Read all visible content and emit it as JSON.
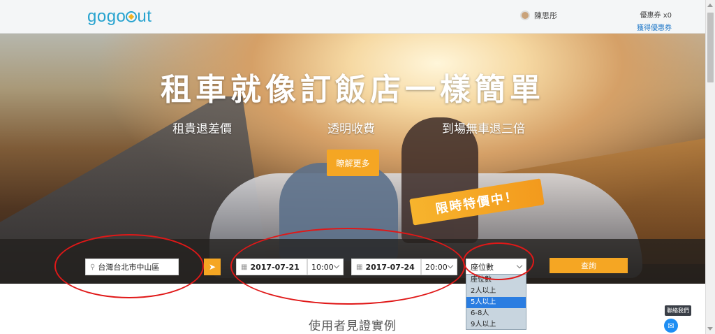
{
  "header": {
    "logo": "gogoout",
    "username": "陳思彤",
    "coupon_count": "優惠券 x0",
    "get_coupon": "獲得優惠券"
  },
  "hero": {
    "title": "租車就像訂飯店一樣簡單",
    "features": [
      "租貴退差價",
      "透明收費",
      "到場無車退三倍"
    ],
    "more_button": "瞭解更多",
    "promo_tag": "限時特價中！"
  },
  "search": {
    "location": "台灣台北市中山區",
    "pickup_date": "2017-07-21",
    "pickup_time": "10:00",
    "return_date": "2017-07-24",
    "return_time": "20:00",
    "seats_placeholder": "座位數",
    "query_button": "查詢",
    "seat_options": [
      "座位數",
      "2人以上",
      "5人以上",
      "6-8人",
      "9人以上"
    ],
    "selected_option": "5人以上"
  },
  "section": {
    "title": "使用者見證實例"
  },
  "chat": {
    "label": "聯絡我們"
  },
  "colors": {
    "brand": "#27a3cf",
    "accent": "#f5a623",
    "annotation": "#e01818",
    "selection": "#2a7de1"
  }
}
